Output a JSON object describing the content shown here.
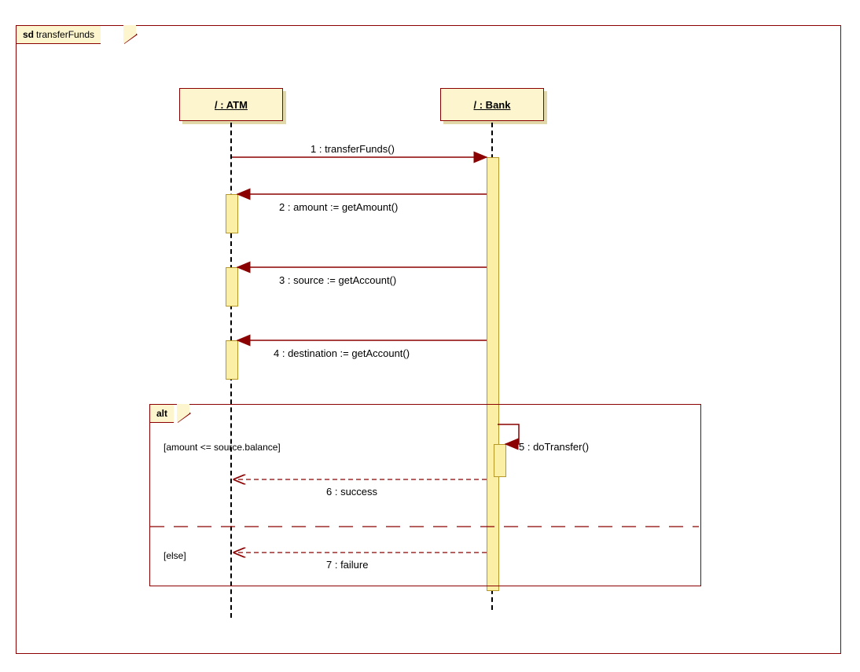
{
  "frame": {
    "prefix": "sd",
    "name": "transferFunds"
  },
  "participants": {
    "atm": "/ : ATM",
    "bank": "/ : Bank"
  },
  "messages": {
    "m1": "1 : transferFunds()",
    "m2": "2 : amount := getAmount()",
    "m3": "3 : source := getAccount()",
    "m4": "4 : destination := getAccount()",
    "m5": "5 : doTransfer()",
    "m6": "6 : success",
    "m7": "7 : failure"
  },
  "alt": {
    "label": "alt",
    "guard_if": "[amount <= source.balance]",
    "guard_else": "[else]"
  }
}
